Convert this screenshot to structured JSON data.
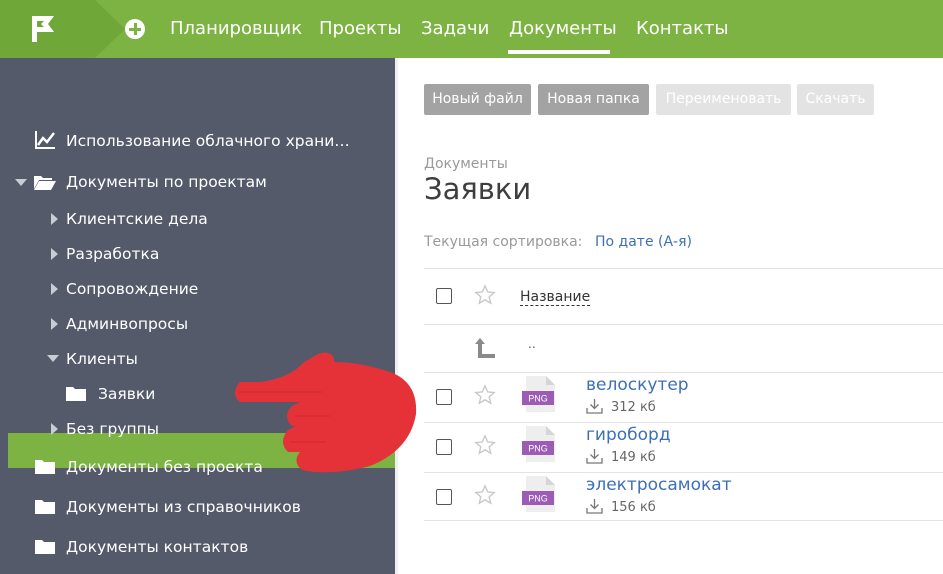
{
  "topbar": {
    "nav": [
      {
        "label": "Планировщик"
      },
      {
        "label": "Проекты"
      },
      {
        "label": "Задачи"
      },
      {
        "label": "Документы"
      },
      {
        "label": "Контакты"
      }
    ],
    "active_nav": "Документы",
    "colors": {
      "bar": "#7cb342",
      "logo_block": "#6fa838"
    }
  },
  "sidebar": {
    "items": [
      {
        "label": "Использование облачного храни…",
        "icon": "chart-icon"
      },
      {
        "label": "Документы по проектам",
        "icon": "folder-open-icon"
      },
      {
        "label": "Клиентские дела",
        "icon": "caret-right-icon"
      },
      {
        "label": "Разработка",
        "icon": "caret-right-icon"
      },
      {
        "label": "Сопровождение",
        "icon": "caret-right-icon"
      },
      {
        "label": "Админвопросы",
        "icon": "caret-right-icon"
      },
      {
        "label": "Клиенты",
        "icon": "caret-down-icon"
      },
      {
        "label": "Заявки",
        "icon": "folder-icon",
        "active": true
      },
      {
        "label": "Без группы",
        "icon": "caret-right-icon"
      },
      {
        "label": "Документы без проекта",
        "icon": "folder-icon"
      },
      {
        "label": "Документы из справочников",
        "icon": "folder-icon"
      },
      {
        "label": "Документы контактов",
        "icon": "folder-icon"
      }
    ],
    "colors": {
      "background": "#545a6a",
      "active": "#7cb342"
    }
  },
  "toolbar": {
    "new_file": "Новый файл",
    "new_folder": "Новая папка",
    "rename": "Переименовать",
    "download": "Скачать"
  },
  "page": {
    "breadcrumb": "Документы",
    "title": "Заявки",
    "sort_label": "Текущая сортировка:",
    "sort_value": "По дате (А-я)"
  },
  "table": {
    "column_name": "Название",
    "parent_dir": "..",
    "files": [
      {
        "name": "велоскутер",
        "size": "312 кб",
        "type": "PNG"
      },
      {
        "name": "гироборд",
        "size": "149 кб",
        "type": "PNG"
      },
      {
        "name": "электросамокат",
        "size": "156 кб",
        "type": "PNG"
      }
    ]
  },
  "colors": {
    "link": "#3d6fb6",
    "png_badge": "#9c5bb5",
    "pointer_hand": "#e53238"
  }
}
